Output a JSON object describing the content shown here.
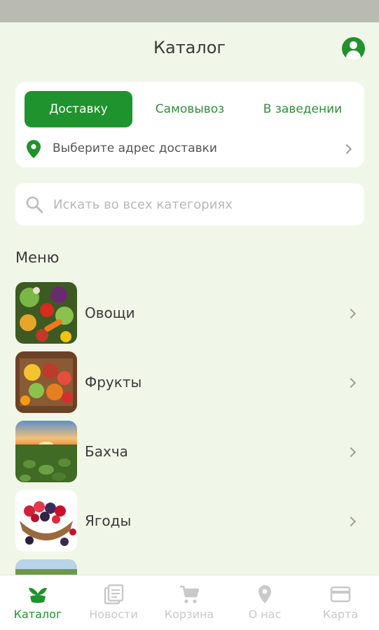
{
  "header": {
    "title": "Каталог"
  },
  "delivery": {
    "tabs": [
      {
        "label": "Доставку",
        "active": true
      },
      {
        "label": "Самовывоз",
        "active": false
      },
      {
        "label": "В заведении",
        "active": false
      }
    ],
    "address_prompt": "Выберите адрес доставки"
  },
  "search": {
    "placeholder": "Искать во всех категориях",
    "value": ""
  },
  "menu": {
    "title": "Меню",
    "items": [
      {
        "label": "Овощи"
      },
      {
        "label": "Фрукты"
      },
      {
        "label": "Бахча"
      },
      {
        "label": "Ягоды"
      },
      {
        "label": ""
      }
    ]
  },
  "bottom_nav": {
    "items": [
      {
        "label": "Каталог",
        "icon": "sprout-icon",
        "active": true
      },
      {
        "label": "Новости",
        "icon": "news-icon",
        "active": false
      },
      {
        "label": "Корзина",
        "icon": "cart-icon",
        "active": false
      },
      {
        "label": "О нас",
        "icon": "location-pin-icon",
        "active": false
      },
      {
        "label": "Карта",
        "icon": "credit-card-icon",
        "active": false
      }
    ]
  },
  "colors": {
    "accent": "#1f932d",
    "background": "#f1f7e8",
    "inactive_nav": "#c9c9c9"
  }
}
